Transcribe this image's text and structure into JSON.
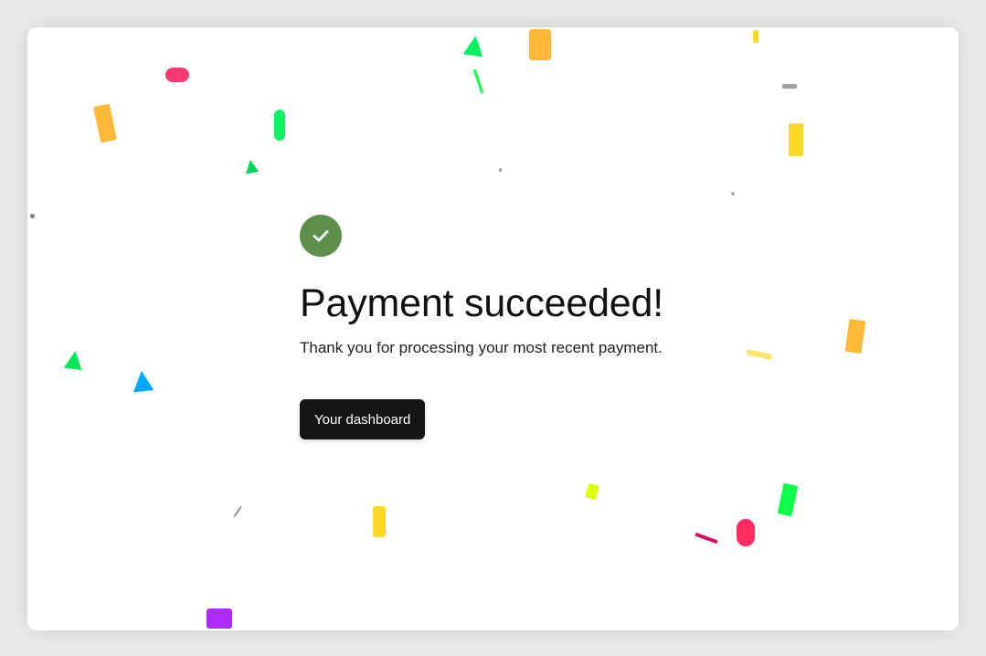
{
  "page": {
    "status_icon": "check-circle-icon",
    "title": "Payment succeeded!",
    "subtitle": "Thank you for processing your most recent payment.",
    "primary_action_label": "Your dashboard"
  },
  "colors": {
    "success": "#5f8f4c",
    "button_bg": "#151515",
    "button_text": "#ffffff",
    "background": "#ffffff"
  }
}
